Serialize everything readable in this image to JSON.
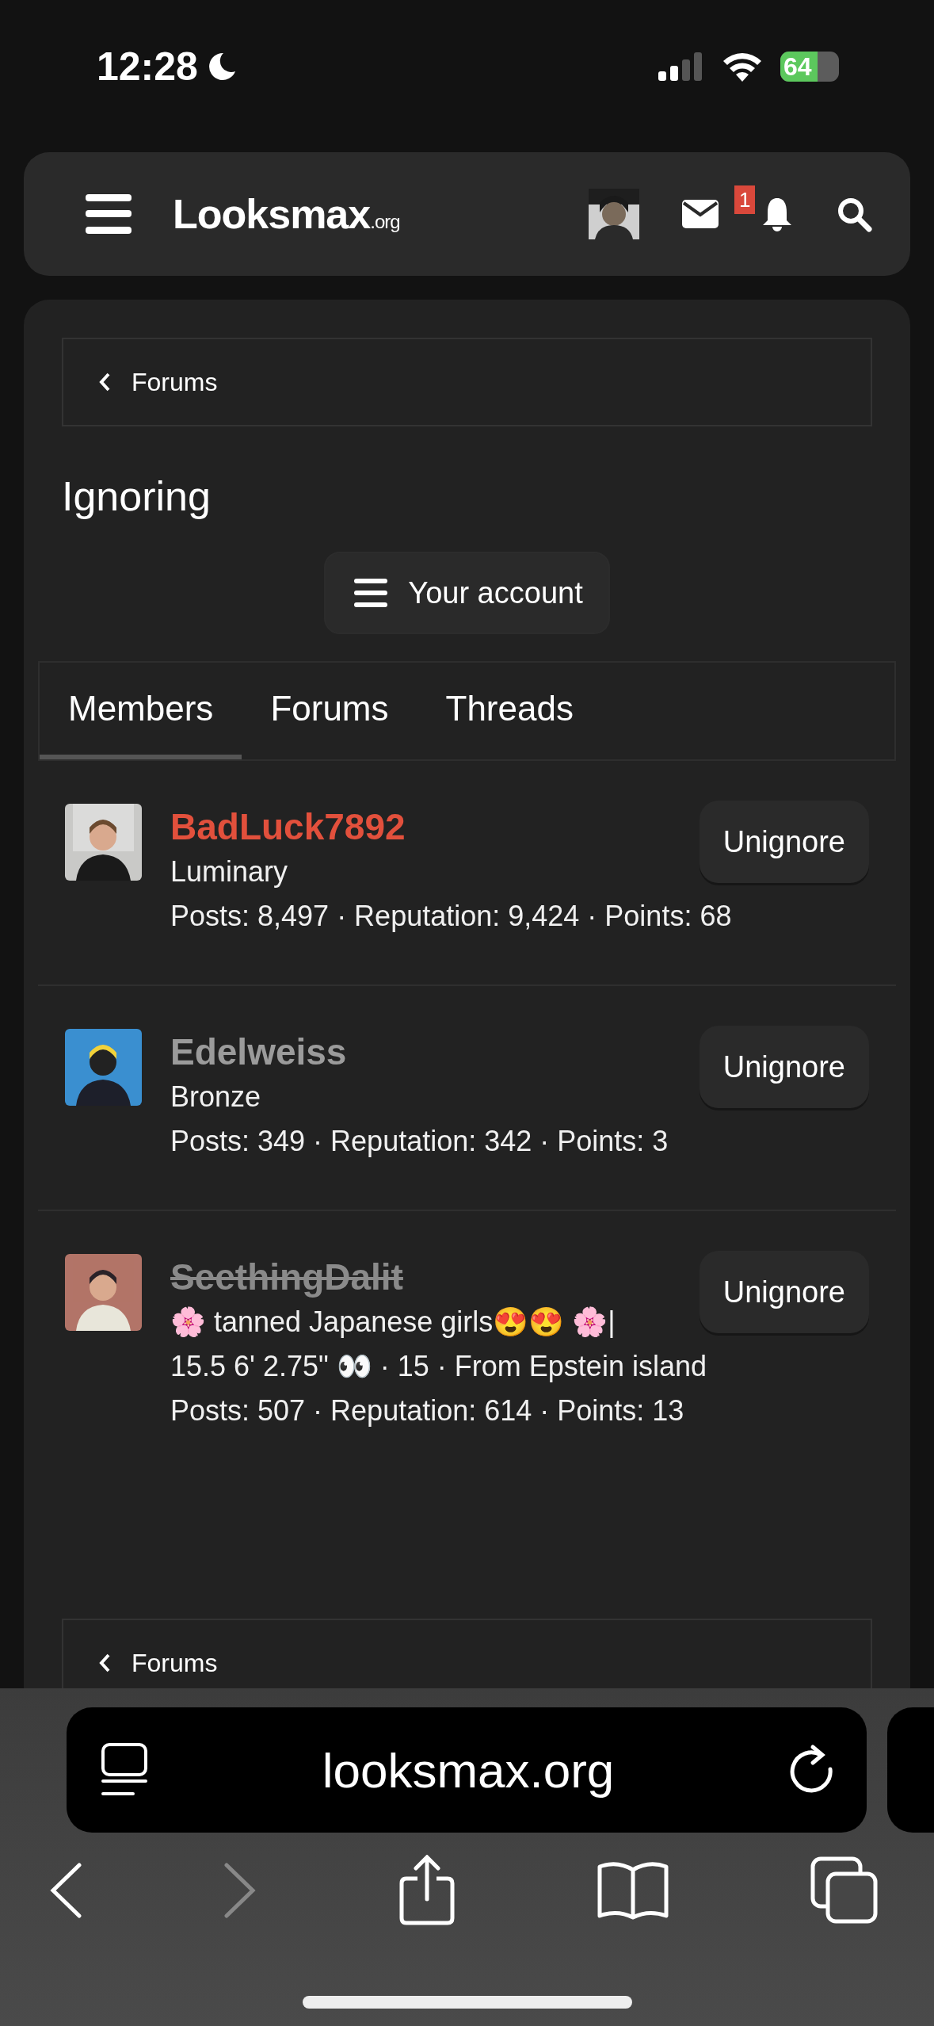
{
  "status_bar": {
    "time": "12:28",
    "battery": "64"
  },
  "header": {
    "logo": "Looksmax",
    "logo_suffix": ".org",
    "notification_count": "1"
  },
  "breadcrumb": {
    "label": "Forums"
  },
  "title": "Ignoring",
  "account_button": "Your account",
  "tabs": [
    {
      "label": "Members",
      "selected": true
    },
    {
      "label": "Forums",
      "selected": false
    },
    {
      "label": "Threads",
      "selected": false
    }
  ],
  "members": [
    {
      "name": "BadLuck7892",
      "color": "#e2503c",
      "banned": false,
      "title": "Luminary",
      "stats": "Posts: 8,497 · Reputation: 9,424 · Points: 68",
      "button": "Unignore"
    },
    {
      "name": "Edelweiss",
      "color": "#9b9b9b",
      "banned": false,
      "title": "Bronze",
      "stats": "Posts: 349 · Reputation: 342 · Points: 3",
      "button": "Unignore"
    },
    {
      "name": "SeethingDalit",
      "color": "#8a8a8a",
      "banned": true,
      "title": "🌸 tanned Japanese girls😍😍 🌸|",
      "extra": "15.5 6' 2.75\" 👀 · 15 · From Epstein island",
      "stats": "Posts: 507 · Reputation: 614 · Points: 13",
      "button": "Unignore"
    }
  ],
  "bottom_breadcrumb": {
    "label": "Forums"
  },
  "browser": {
    "url": "looksmax.org",
    "back_disabled": false,
    "forward_disabled": true
  }
}
